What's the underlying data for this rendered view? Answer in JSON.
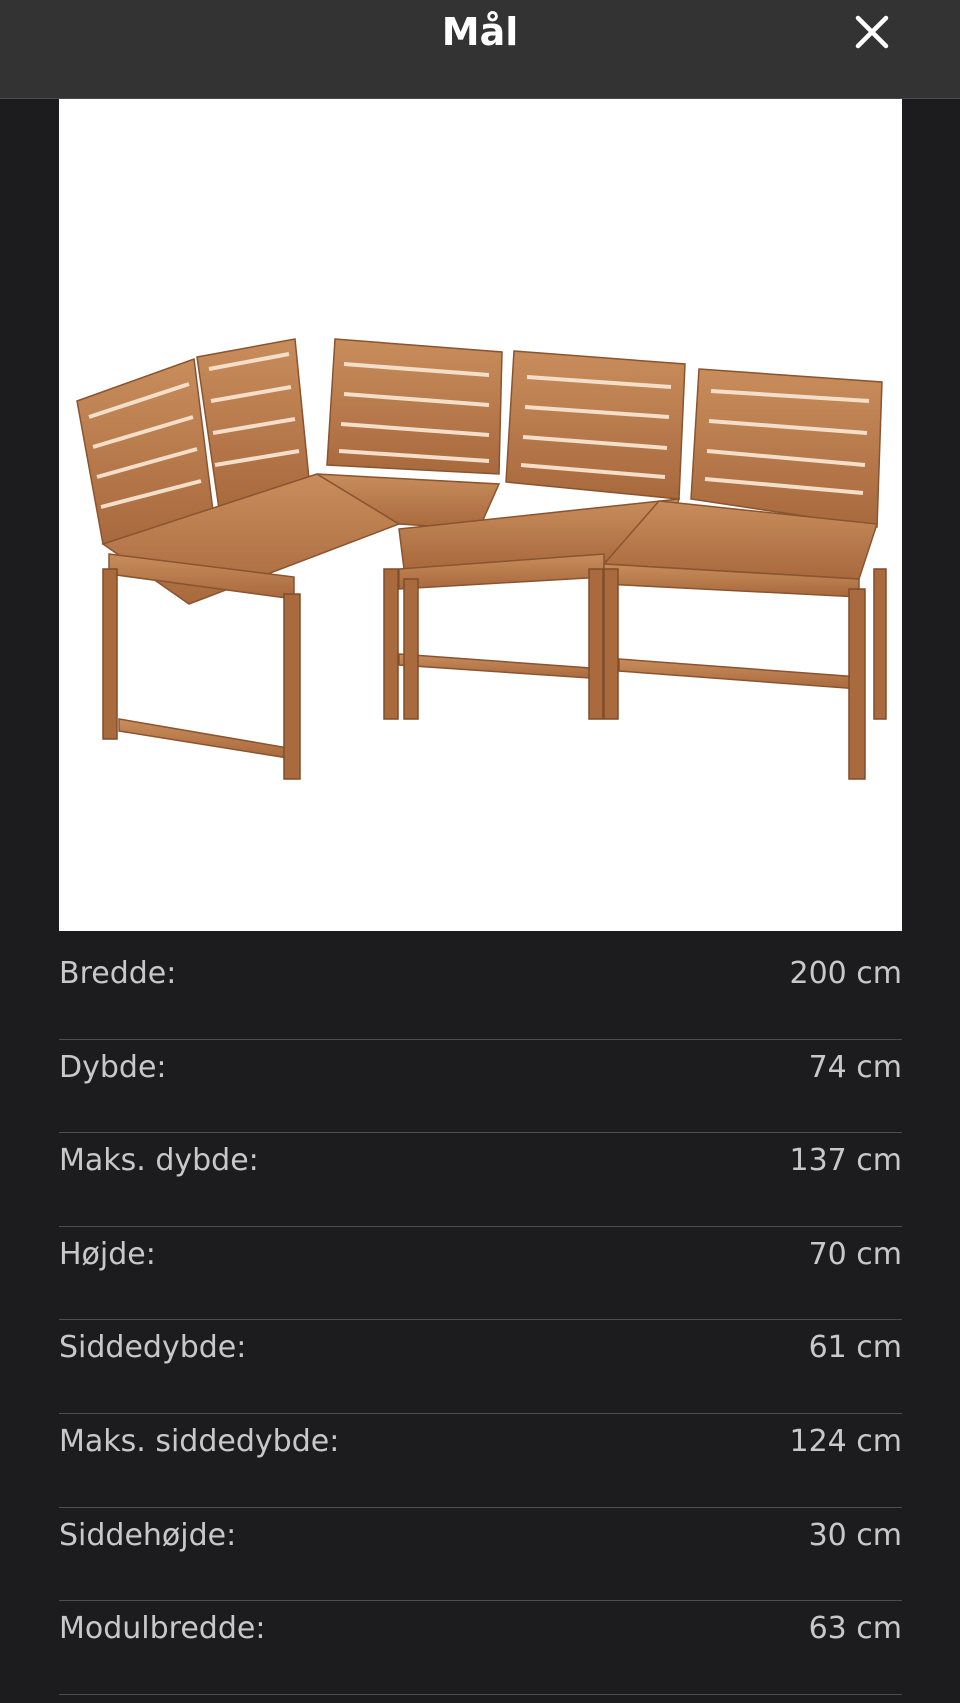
{
  "header": {
    "title": "Mål",
    "close_icon": "close-icon"
  },
  "product_image": {
    "alt": "sofa-illustration"
  },
  "specs": [
    {
      "label": "Bredde:",
      "value": "200 cm"
    },
    {
      "label": "Dybde:",
      "value": "74 cm"
    },
    {
      "label": "Maks. dybde:",
      "value": "137 cm"
    },
    {
      "label": "Højde:",
      "value": "70 cm"
    },
    {
      "label": "Siddedybde:",
      "value": "61 cm"
    },
    {
      "label": "Maks. siddedybde:",
      "value": "124 cm"
    },
    {
      "label": "Siddehøjde:",
      "value": "30 cm"
    },
    {
      "label": "Modulbredde:",
      "value": "63 cm"
    }
  ],
  "colors": {
    "background": "#1c1c1e",
    "topbar": "#333333",
    "text": "#c8c8cb",
    "divider": "#4d4d50",
    "wood": "#b87a4b"
  }
}
